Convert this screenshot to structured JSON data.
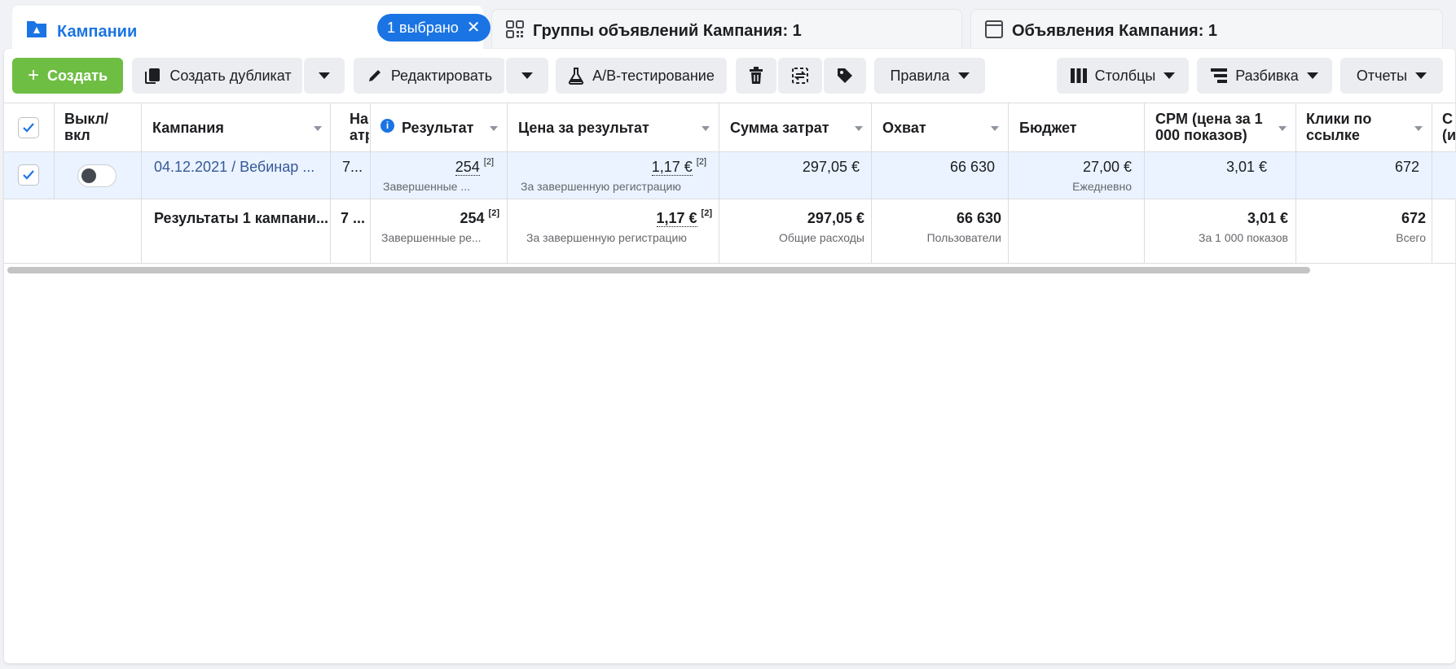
{
  "tabs": {
    "campaigns": {
      "label": "Кампании",
      "selected_pill": "1 выбрано"
    },
    "adsets": {
      "label": "Группы объявлений Кампания: 1"
    },
    "ads": {
      "label": "Объявления Кампания: 1"
    }
  },
  "toolbar": {
    "create": "Создать",
    "duplicate": "Создать дубликат",
    "edit": "Редактировать",
    "ab_test": "A/B-тестирование",
    "rules": "Правила",
    "columns": "Столбцы",
    "breakdown": "Разбивка",
    "reports": "Отчеты"
  },
  "table": {
    "headers": {
      "toggle_l1": "Выкл/",
      "toggle_l2": "вкл",
      "campaign": "Кампания",
      "attr_l1": "На",
      "attr_l2": "атр",
      "result": "Результат",
      "cost_per_result": "Цена за результат",
      "spend": "Сумма затрат",
      "reach": "Охват",
      "budget": "Бюджет",
      "cpm_l1": "CPM (цена за 1",
      "cpm_l2": "000 показов)",
      "clicks_l1": "Клики по",
      "clicks_l2": "ссылке",
      "next_l1": "С",
      "next_l2": "(и"
    },
    "row": {
      "campaign": "04.12.2021 / Вебинар ...",
      "attr": "7...",
      "result": "254",
      "result_sup": "[2]",
      "result_sub": "Завершенные ...",
      "cost": "1,17 €",
      "cost_sup": "[2]",
      "cost_sub": "За завершенную регистрацию",
      "spend": "297,05 €",
      "reach": "66 630",
      "budget": "27,00 €",
      "budget_sub": "Ежедневно",
      "cpm": "3,01 €",
      "clicks": "672"
    },
    "summary": {
      "campaign": "Результаты 1 кампани...",
      "attr": "7 ...",
      "result": "254",
      "result_sup": "[2]",
      "result_sub": "Завершенные ре...",
      "cost": "1,17 €",
      "cost_sup": "[2]",
      "cost_sub": "За завершенную регистрацию",
      "spend": "297,05 €",
      "spend_sub": "Общие расходы",
      "reach": "66 630",
      "reach_sub": "Пользователи",
      "cpm": "3,01 €",
      "cpm_sub": "За 1 000 показов",
      "clicks": "672",
      "clicks_sub": "Всего"
    }
  },
  "colors": {
    "accent": "#1b74e4",
    "create_green": "#6fbe44",
    "selected_row": "#eaf3ff"
  }
}
